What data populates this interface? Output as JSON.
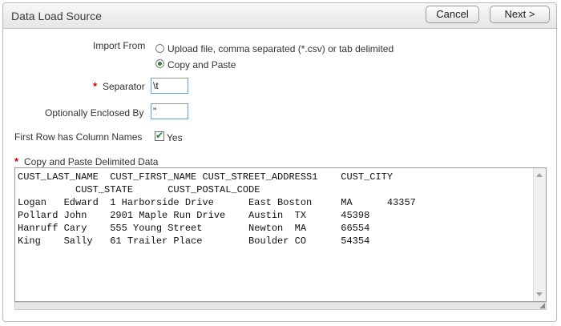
{
  "header": {
    "title": "Data Load Source",
    "cancel_label": "Cancel",
    "next_label": "Next >"
  },
  "form": {
    "import_from": {
      "label": "Import From",
      "options": [
        {
          "label": "Upload file, comma separated (*.csv) or tab delimited",
          "selected": false
        },
        {
          "label": "Copy and Paste",
          "selected": true
        }
      ]
    },
    "separator": {
      "required_marker": "*",
      "label": "Separator",
      "value": "\\t"
    },
    "enclosed_by": {
      "label": "Optionally Enclosed By",
      "value": "\""
    },
    "first_row": {
      "label": "First Row has Column Names",
      "checked": true,
      "option_label": "Yes"
    },
    "data": {
      "required_marker": "*",
      "label": "Copy and Paste Delimited Data",
      "text": "CUST_LAST_NAME  CUST_FIRST_NAME CUST_STREET_ADDRESS1    CUST_CITY\n          CUST_STATE      CUST_POSTAL_CODE\nLogan   Edward  1 Harborside Drive      East Boston     MA      43357\nPollard John    2901 Maple Run Drive    Austin  TX      45398\nHanruff Cary    555 Young Street        Newton  MA      66554\nKing    Sally   61 Trailer Place        Boulder CO      54354"
    }
  },
  "colors": {
    "required": "#cc0000",
    "check": "#2e7d32"
  }
}
